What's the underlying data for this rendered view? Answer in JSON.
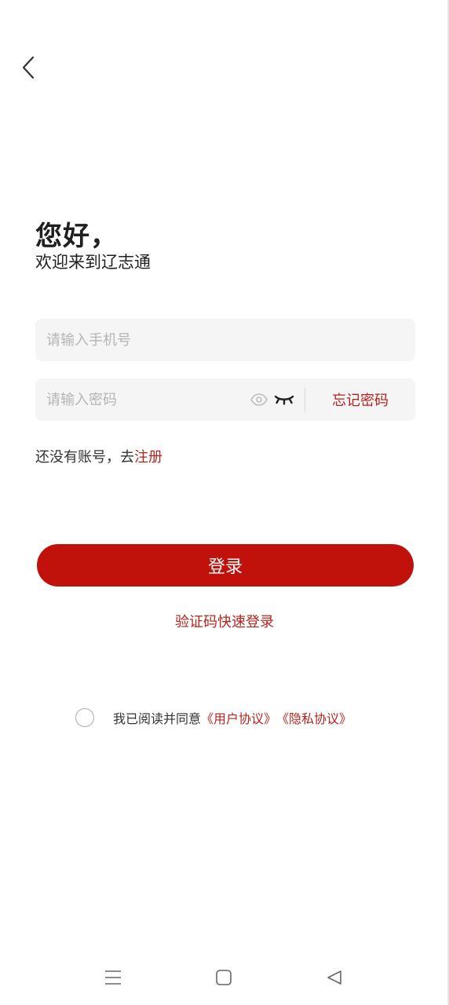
{
  "header": {
    "back_icon": "chevron-left-icon"
  },
  "greeting": {
    "title": "您好，",
    "subtitle": "欢迎来到辽志通"
  },
  "form": {
    "phone_placeholder": "请输入手机号",
    "phone_value": "",
    "password_placeholder": "请输入密码",
    "password_value": "",
    "show_password_icon": "eye-icon",
    "hide_password_icon": "eye-closed-icon",
    "forgot_password_label": "忘记密码"
  },
  "register": {
    "prompt": "还没有账号，去",
    "link_label": "注册"
  },
  "login_button_label": "登录",
  "sms_login_label": "验证码快速登录",
  "agreement": {
    "checked": false,
    "text": "我已阅读并同意",
    "user_agreement": "《用户协议》",
    "privacy_agreement": "《隐私协议》"
  },
  "system_nav": {
    "menu_icon": "menu-icon",
    "home_icon": "home-square-icon",
    "back_icon": "back-triangle-icon"
  },
  "colors": {
    "accent": "#c1110b",
    "link": "#b5241f",
    "input_bg": "#f5f5f5",
    "placeholder": "#b5b5b5"
  }
}
